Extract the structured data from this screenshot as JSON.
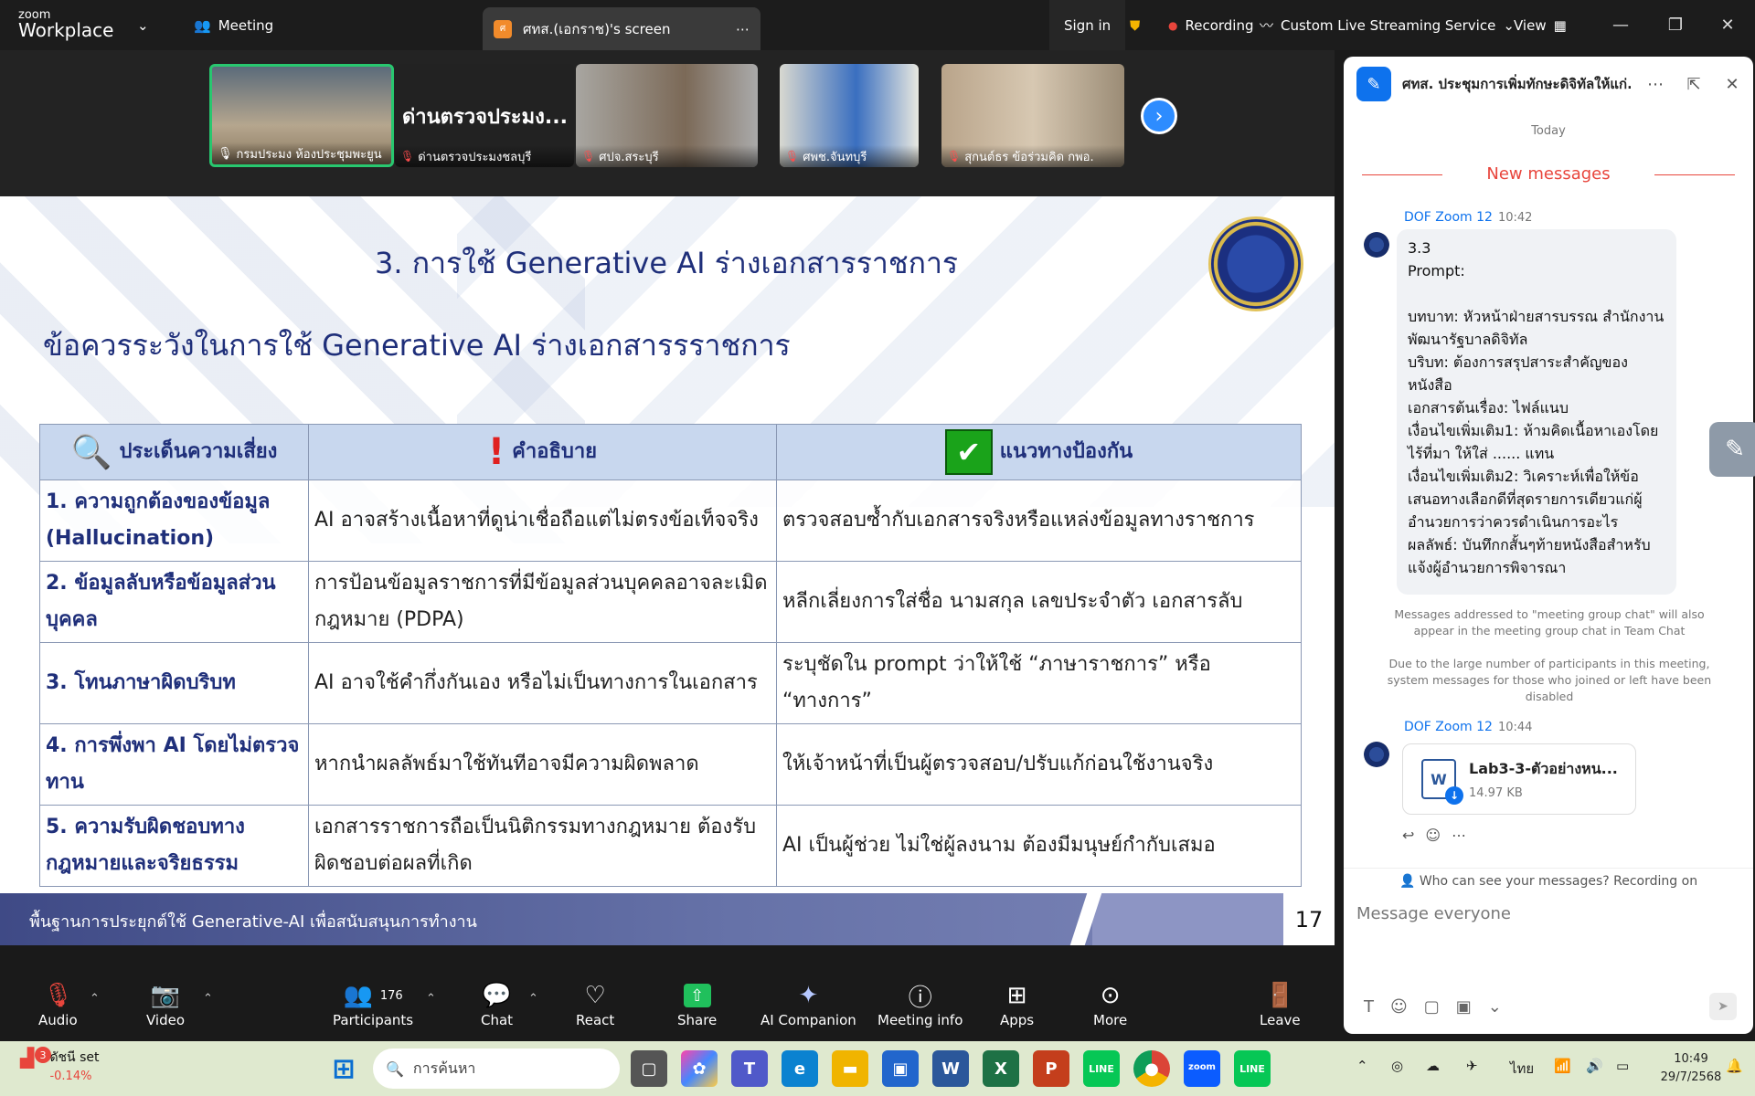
{
  "app": {
    "logo_small": "zoom",
    "logo_big": "Workplace"
  },
  "topbar": {
    "meeting_label": "Meeting",
    "share_tab": "ศทส.(เอกราช)'s screen",
    "share_initial": "ศ",
    "sign_in": "Sign in",
    "recording": "Recording",
    "streaming": "Custom Live Streaming Service",
    "view": "View"
  },
  "thumbnails": [
    {
      "name": "กรมประมง ห้องประชุมพะยูน"
    },
    {
      "name": "ด่านตรวจประมงชลบุรี",
      "big": "ด่านตรวจประมง..."
    },
    {
      "name": "ศปจ.สระบุรี"
    },
    {
      "name": "ศพช.จันทบุรี"
    },
    {
      "name": "สุกนต์ธร ข้อร่วมคิด กพอ."
    }
  ],
  "slide": {
    "title": "3. การใช้ Generative AI ร่างเอกสารราชการ",
    "subtitle": "ข้อควรระวังในการใช้ Generative AI ร่างเอกสารรราชการ",
    "headers": [
      "ประเด็นความเสี่ยง",
      "คำอธิบาย",
      "แนวทางป้องกัน"
    ],
    "rows": [
      [
        "1. ความถูกต้องของข้อมูล (Hallucination)",
        "AI อาจสร้างเนื้อหาที่ดูน่าเชื่อถือแต่ไม่ตรงข้อเท็จจริง",
        "ตรวจสอบซ้ำกับเอกสารจริงหรือแหล่งข้อมูลทางราชการ"
      ],
      [
        "2. ข้อมูลลับหรือข้อมูลส่วนบุคคล",
        "การป้อนข้อมูลราชการที่มีข้อมูลส่วนบุคคลอาจละเมิดกฎหมาย (PDPA)",
        "หลีกเลี่ยงการใส่ชื่อ นามสกุล เลขประจำตัว เอกสารลับ"
      ],
      [
        "3. โทนภาษาผิดบริบท",
        "AI อาจใช้คำกึ่งกันเอง หรือไม่เป็นทางการในเอกสาร",
        "ระบุชัดใน prompt ว่าให้ใช้ “ภาษาราชการ” หรือ “ทางการ”"
      ],
      [
        "4. การพึ่งพา AI โดยไม่ตรวจทาน",
        "หากนำผลลัพธ์มาใช้ทันทีอาจมีความผิดพลาด",
        "ให้เจ้าหน้าที่เป็นผู้ตรวจสอบ/ปรับแก้ก่อนใช้งานจริง"
      ],
      [
        "5. ความรับผิดชอบทางกฎหมายและจริยธรรม",
        "เอกสารราชการถือเป็นนิติกรรมทางกฎหมาย ต้องรับผิดชอบต่อผลที่เกิด",
        "AI เป็นผู้ช่วย ไม่ใช่ผู้ลงนาม ต้องมีมนุษย์กำกับเสมอ"
      ]
    ],
    "footer": "พื้นฐานการประยุกต์ใช้ Generative-AI เพื่อสนับสนุนการทำงาน",
    "page": "17"
  },
  "chat": {
    "title": "ศทส. ประชุมการเพิ่มทักษะดิจิทัลให้แก่...",
    "today": "Today",
    "new_messages": "New messages",
    "msg1_sender": "DOF Zoom 12",
    "msg1_time": "10:42",
    "msg1_text": "3.3\nPrompt:\n\nบทบาท: หัวหน้าฝ่ายสารบรรณ สำนักงานพัฒนารัฐบาลดิจิทัล\nบริบท: ต้องการสรุปสาระสำคัญของหนังสือ\nเอกสารต้นเรื่อง: ไฟล์แนบ\nเงื่อนไขเพิ่มเติม1: ห้ามคิดเนื้อหาเองโดยไร้ที่มา ให้ใส่ ...... แทน\nเงื่อนไขเพิ่มเติม2: วิเคราะห์เพื่อให้ข้อเสนอทางเลือกดีที่สุดรายการเดียวแก่ผู้อำนวยการว่าควรดำเนินการอะไร\nผลลัพธ์: บันทึกกสั้นๆท้ายหนังสือสำหรับแจ้งผู้อำนวยการพิจารณา",
    "note1": "Messages addressed to \"meeting group chat\" will also appear in the meeting group chat in Team Chat",
    "note2": "Due to the large number of participants in this meeting, system messages for those who joined or left have been disabled",
    "msg2_sender": "DOF Zoom 12",
    "msg2_time": "10:44",
    "file_name": "Lab3-3-ตัวอย่างหน...",
    "file_size": "14.97 KB",
    "who_can_see": "Who can see your messages? Recording on",
    "placeholder": "Message everyone"
  },
  "toolbar": {
    "audio": "Audio",
    "video": "Video",
    "participants": "Participants",
    "participants_count": "176",
    "chat": "Chat",
    "react": "React",
    "share": "Share",
    "ai": "AI Companion",
    "info": "Meeting info",
    "apps": "Apps",
    "more": "More",
    "leave": "Leave"
  },
  "taskbar": {
    "weather_label": "ดัชนี set",
    "weather_value": "-0.14%",
    "weather_badge": "3",
    "search_placeholder": "การค้นหา",
    "lang": "ไทย",
    "time": "10:49",
    "date": "29/7/2568"
  }
}
